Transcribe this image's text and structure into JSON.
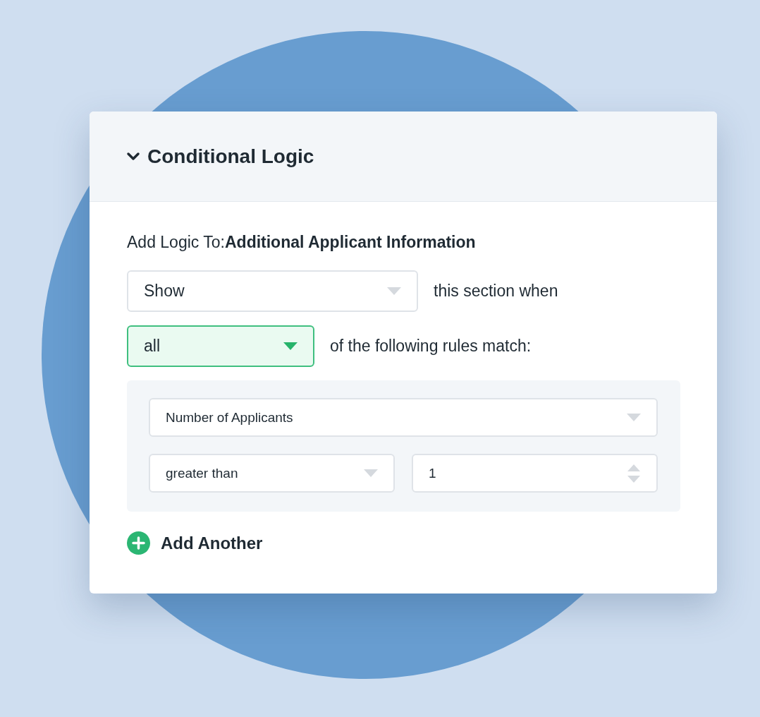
{
  "panel": {
    "title": "Conditional Logic",
    "expanded": true
  },
  "target": {
    "label": "Add Logic To:",
    "name": "Additional Applicant Information"
  },
  "action": {
    "value": "Show",
    "focused": false,
    "suffix": "this section when"
  },
  "match": {
    "value": "all",
    "focused": true,
    "suffix": "of the following rules match:"
  },
  "rules": [
    {
      "field": "Number of Applicants",
      "operator": "greater than",
      "value": "1"
    }
  ],
  "add_button": {
    "label": "Add Another"
  }
}
